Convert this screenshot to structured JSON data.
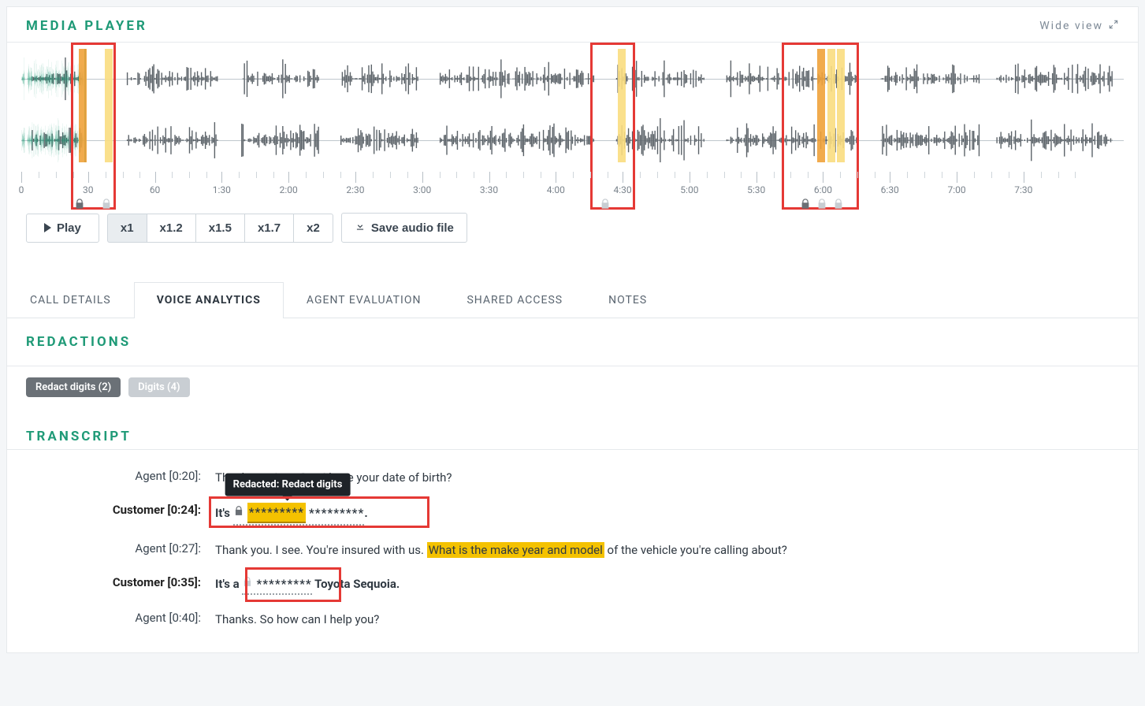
{
  "header": {
    "title": "MEDIA PLAYER",
    "wide_view": "Wide view"
  },
  "controls": {
    "play": "Play",
    "speeds": [
      "x1",
      "x1.2",
      "x1.5",
      "x1.7",
      "x2"
    ],
    "active_speed": 0,
    "save_audio": "Save audio file"
  },
  "timeline": {
    "labels": [
      "0",
      "30",
      "60",
      "1:30",
      "2:00",
      "2:30",
      "3:00",
      "3:30",
      "4:00",
      "4:30",
      "5:00",
      "5:30",
      "6:00",
      "6:30",
      "7:00",
      "7:30"
    ],
    "played_percent": 5.7
  },
  "tabs": {
    "items": [
      "CALL DETAILS",
      "VOICE ANALYTICS",
      "AGENT EVALUATION",
      "SHARED ACCESS",
      "NOTES"
    ],
    "active": 1
  },
  "redactions": {
    "title": "REDACTIONS",
    "pill_redact": "Redact digits (2)",
    "pill_digits": "Digits (4)"
  },
  "transcript": {
    "title": "TRANSCRIPT",
    "tooltip": "Redacted: Redact digits",
    "rows": [
      {
        "speaker": "Agent",
        "time": "0:20",
        "bold": false
      },
      {
        "speaker": "Customer",
        "time": "0:24",
        "bold": true
      },
      {
        "speaker": "Agent",
        "time": "0:27",
        "bold": false
      },
      {
        "speaker": "Customer",
        "time": "0:35",
        "bold": true
      },
      {
        "speaker": "Agent",
        "time": "0:40",
        "bold": false
      }
    ],
    "r0_text": "Thank you Ann. Can I have your date of birth?",
    "r1_prefix": "It's",
    "r1_stars1": "*********",
    "r1_stars2": "*********",
    "r1_suffix": ".",
    "r2_pre": "Thank you. I see. You're insured with us. ",
    "r2_hl": "What is the make year and model",
    "r2_post": " of the vehicle you're calling about?",
    "r3_prefix": "It's a",
    "r3_stars": "*********",
    "r3_suffix": " Toyota Sequoia.",
    "r4_text": "Thanks. So how can I help you?"
  }
}
